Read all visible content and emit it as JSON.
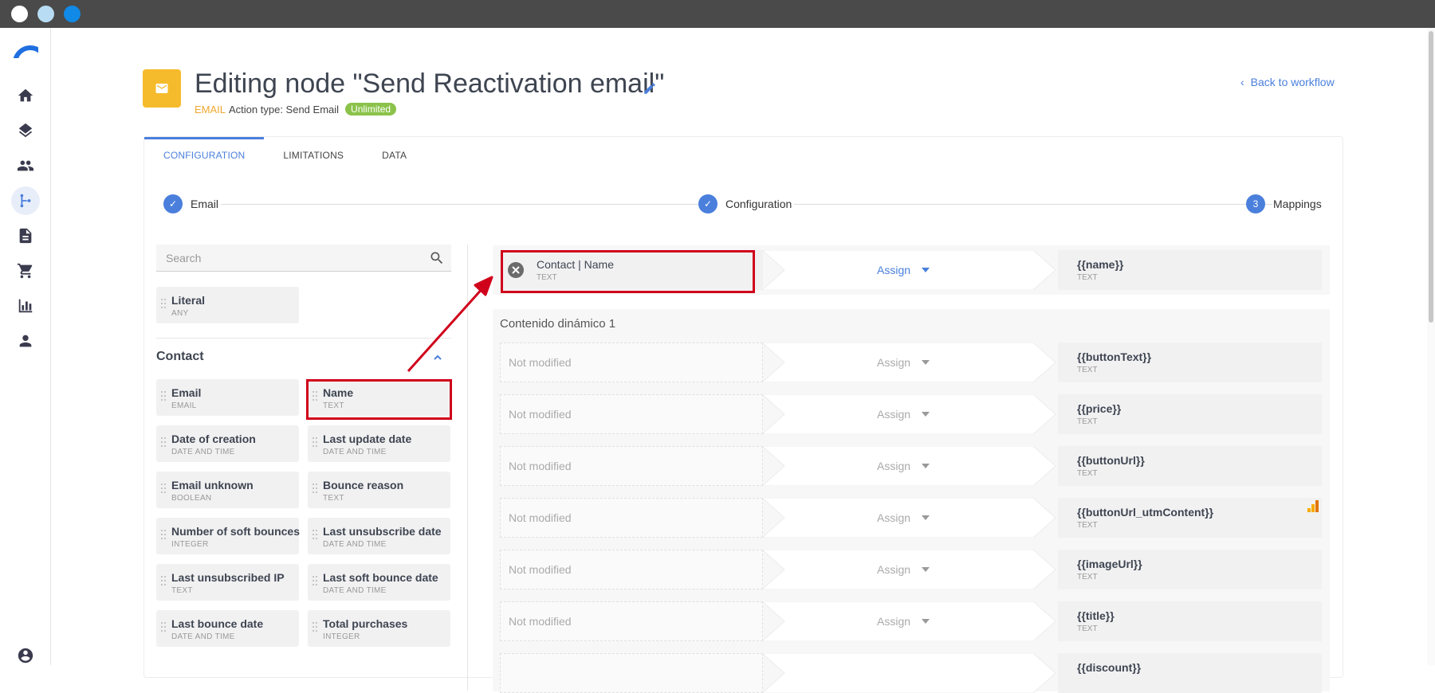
{
  "window": {
    "controls": [
      "close",
      "minimize",
      "maximize"
    ]
  },
  "sidebar": {
    "logo": "logo-icon",
    "items": [
      {
        "name": "home",
        "icon": "home-icon",
        "active": false
      },
      {
        "name": "layers",
        "icon": "layers-icon",
        "active": false
      },
      {
        "name": "contacts",
        "icon": "people-icon",
        "active": false
      },
      {
        "name": "workflows",
        "icon": "workflow-icon",
        "active": true
      },
      {
        "name": "documents",
        "icon": "document-icon",
        "active": false
      },
      {
        "name": "cart",
        "icon": "cart-icon",
        "active": false
      },
      {
        "name": "reports",
        "icon": "chart-icon",
        "active": false
      },
      {
        "name": "users",
        "icon": "person-icon",
        "active": false
      }
    ],
    "account_icon": "account-icon"
  },
  "header": {
    "title": "Editing node \"Send Reactivation email\"",
    "type_tag": "EMAIL",
    "action_type": "Action type: Send Email",
    "badge": "Unlimited",
    "back_label": "Back to workflow",
    "node_color": "#f6bb2c",
    "accent": "#4a7fdc"
  },
  "tabs": [
    {
      "label": "CONFIGURATION",
      "active": true
    },
    {
      "label": "LIMITATIONS",
      "active": false
    },
    {
      "label": "DATA",
      "active": false
    }
  ],
  "stepper": {
    "steps": [
      {
        "label": "Email",
        "state": "done"
      },
      {
        "label": "Configuration",
        "state": "done"
      },
      {
        "label": "Mappings",
        "state": "current",
        "number": "3"
      }
    ]
  },
  "fields_panel": {
    "search_placeholder": "Search",
    "literal": {
      "name": "Literal",
      "type": "ANY"
    },
    "group_title": "Contact",
    "fields": [
      {
        "name": "Email",
        "type": "EMAIL"
      },
      {
        "name": "Name",
        "type": "TEXT"
      },
      {
        "name": "Date of creation",
        "type": "DATE AND TIME"
      },
      {
        "name": "Last update date",
        "type": "DATE AND TIME"
      },
      {
        "name": "Email unknown",
        "type": "BOOLEAN"
      },
      {
        "name": "Bounce reason",
        "type": "TEXT"
      },
      {
        "name": "Number of soft bounces",
        "type": "INTEGER"
      },
      {
        "name": "Last unsubscribe date",
        "type": "DATE AND TIME"
      },
      {
        "name": "Last unsubscribed IP",
        "type": "TEXT"
      },
      {
        "name": "Last soft bounce date",
        "type": "DATE AND TIME"
      },
      {
        "name": "Last bounce date",
        "type": "DATE AND TIME"
      },
      {
        "name": "Total purchases",
        "type": "INTEGER"
      }
    ]
  },
  "mappings": {
    "top": {
      "source": "Contact | Name",
      "source_type": "TEXT",
      "assign": "Assign",
      "target": "{{name}}",
      "target_type": "TEXT"
    },
    "section_title": "Contenido dinámico 1",
    "rows": [
      {
        "source": "Not modified",
        "assign": "Assign",
        "target": "{{buttonText}}",
        "target_type": "TEXT"
      },
      {
        "source": "Not modified",
        "assign": "Assign",
        "target": "{{price}}",
        "target_type": "TEXT"
      },
      {
        "source": "Not modified",
        "assign": "Assign",
        "target": "{{buttonUrl}}",
        "target_type": "TEXT"
      },
      {
        "source": "Not modified",
        "assign": "Assign",
        "target": "{{buttonUrl_utmContent}}",
        "target_type": "TEXT",
        "icon": "analytics-icon"
      },
      {
        "source": "Not modified",
        "assign": "Assign",
        "target": "{{imageUrl}}",
        "target_type": "TEXT"
      },
      {
        "source": "Not modified",
        "assign": "Assign",
        "target": "{{title}}",
        "target_type": "TEXT"
      },
      {
        "source": "",
        "assign": "",
        "target": "{{discount}}",
        "target_type": ""
      }
    ]
  },
  "annotation_color": "#d0021b"
}
